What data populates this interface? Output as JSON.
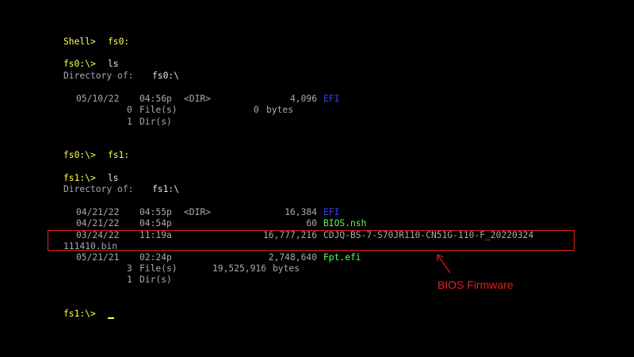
{
  "colors": {
    "background": "#000000",
    "prompt": "#ffff55",
    "text": "#e8e8e8",
    "gray": "#aaaaaa",
    "dir": "#3340ff",
    "file": "#55ff55",
    "annotation": "#e02020"
  },
  "session": {
    "cmd1": {
      "prompt": "Shell>",
      "command": "fs0:"
    },
    "cmd2": {
      "prompt": "fs0:\\>",
      "command": "ls"
    },
    "dir0": {
      "label": "Directory of:",
      "path": "fs0:\\"
    },
    "fs0_entries": [
      {
        "date": "05/10/22",
        "time": "04:56p",
        "type": "<DIR>",
        "size": "4,096",
        "name": "EFI"
      }
    ],
    "fs0_summary": {
      "files_count": "0",
      "files_label": "File(s)",
      "files_bytes": "0",
      "bytes_label": "bytes",
      "dirs_count": "1",
      "dirs_label": "Dir(s)"
    },
    "cmd3": {
      "prompt": "fs0:\\>",
      "command": "fs1:"
    },
    "cmd4": {
      "prompt": "fs1:\\>",
      "command": "ls"
    },
    "dir1": {
      "label": "Directory of:",
      "path": "fs1:\\"
    },
    "fs1_entries": [
      {
        "date": "04/21/22",
        "time": "04:55p",
        "type": "<DIR>",
        "size": "16,384",
        "name": "EFI"
      },
      {
        "date": "04/21/22",
        "time": "04:54p",
        "type": "",
        "size": "60",
        "name": "BIOS.nsh"
      },
      {
        "date": "03/24/22",
        "time": "11:19a",
        "type": "",
        "size": "16,777,216",
        "name": "CDJQ-BS-7-S70JR110-CN51G-110-F_20220324",
        "name_cont": "111410.bin"
      },
      {
        "date": "05/21/21",
        "time": "02:24p",
        "type": "",
        "size": "2,748,640",
        "name": "Fpt.efi"
      }
    ],
    "fs1_summary": {
      "files_count": "3",
      "files_label": "File(s)",
      "files_bytes": "19,525,916",
      "bytes_label": "bytes",
      "dirs_count": "1",
      "dirs_label": "Dir(s)"
    },
    "final_prompt": "fs1:\\>"
  },
  "annotation": {
    "label": "BIOS Firmware"
  }
}
